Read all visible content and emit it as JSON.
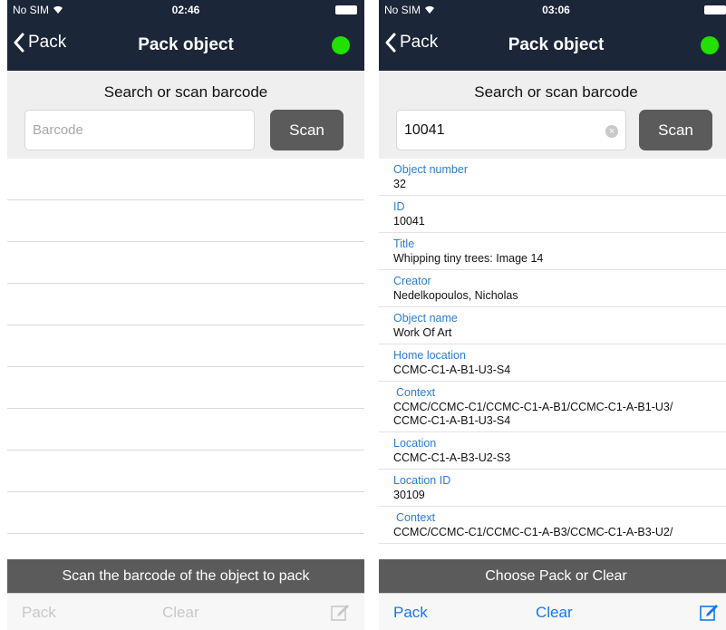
{
  "left_screen": {
    "status": {
      "carrier": "No SIM",
      "time": "02:46"
    },
    "nav": {
      "back_label": "Pack",
      "title": "Pack object"
    },
    "search": {
      "heading": "Search or scan barcode",
      "placeholder": "Barcode",
      "scan_label": "Scan"
    },
    "hint": "Scan the barcode of the object to pack",
    "toolbar": {
      "pack_label": "Pack",
      "clear_label": "Clear"
    }
  },
  "right_screen": {
    "status": {
      "carrier": "No SIM",
      "time": "03:06"
    },
    "nav": {
      "back_label": "Pack",
      "title": "Pack object"
    },
    "search": {
      "heading": "Search or scan barcode",
      "value": "10041",
      "scan_label": "Scan"
    },
    "fields": [
      {
        "label": "Object number",
        "value": "32"
      },
      {
        "label": "ID",
        "value": "10041"
      },
      {
        "label": "Title",
        "value": "Whipping tiny trees: Image 14"
      },
      {
        "label": "Creator",
        "value": "Nedelkopoulos, Nicholas"
      },
      {
        "label": "Object name",
        "value": "Work Of Art"
      },
      {
        "label": "Home location",
        "value": "CCMC-C1-A-B1-U3-S4"
      },
      {
        "label": "Context",
        "value": "CCMC/CCMC-C1/CCMC-C1-A-B1/CCMC-C1-A-B1-U3/\nCCMC-C1-A-B1-U3-S4"
      },
      {
        "label": "Location",
        "value": "CCMC-C1-A-B3-U2-S3"
      },
      {
        "label": "Location ID",
        "value": "30109"
      },
      {
        "label": "Context",
        "value": "CCMC/CCMC-C1/CCMC-C1-A-B3/CCMC-C1-A-B3-U2/"
      }
    ],
    "hint": "Choose Pack or Clear",
    "toolbar": {
      "pack_label": "Pack",
      "clear_label": "Clear"
    }
  },
  "colors": {
    "nav_bg": "#1b2638",
    "status_dot": "#22e000",
    "accent": "#1478f0",
    "label_blue": "#2a7dd4",
    "hint_bg": "#5b5b5b"
  },
  "icons": {
    "back": "chevron-left-icon",
    "status": "connection-status-dot",
    "clear": "clear-text-icon",
    "compose": "compose-icon",
    "wifi": "wifi-icon",
    "battery": "battery-icon"
  }
}
